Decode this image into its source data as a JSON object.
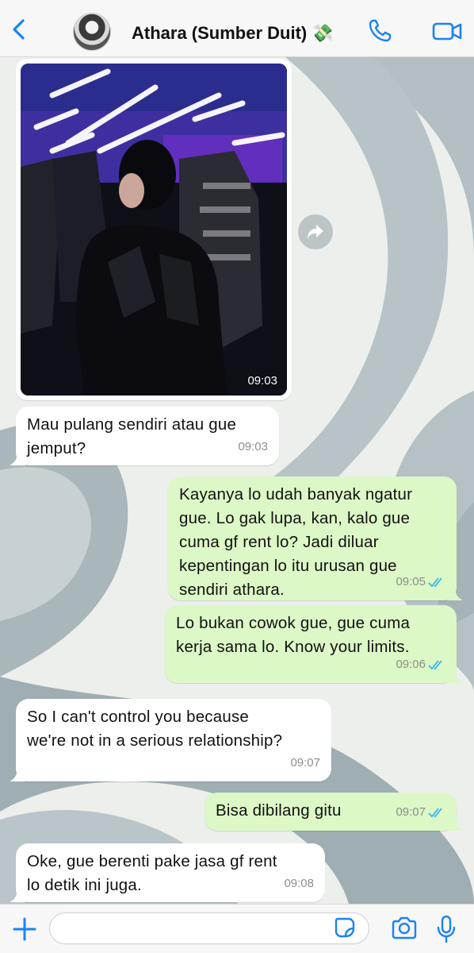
{
  "header": {
    "contact_name": "Athara (Sumber Duit) 💸",
    "icons": [
      "back-chevron-icon",
      "phone-icon",
      "video-camera-icon"
    ]
  },
  "colors": {
    "accent": "#1a82f7",
    "incoming_bubble": "#ffffff",
    "outgoing_bubble": "#dcf8c6",
    "read_ticks": "#34b7f1"
  },
  "messages": [
    {
      "direction": "in",
      "type": "image",
      "time": "09:03"
    },
    {
      "direction": "in",
      "lines": [
        "Mau pulang sendiri atau gue",
        "jemput?"
      ],
      "time": "09:03"
    },
    {
      "direction": "out",
      "lines": [
        "Kayanya lo udah banyak ngatur",
        "gue. Lo gak lupa, kan, kalo gue",
        "cuma gf rent lo? Jadi diluar",
        "kepentingan lo itu urusan gue",
        "sendiri athara."
      ],
      "time": "09:05",
      "status": "read"
    },
    {
      "direction": "out",
      "lines": [
        "Lo bukan cowok gue, gue cuma",
        "kerja sama lo. Know your limits."
      ],
      "time": "09:06",
      "status": "read"
    },
    {
      "direction": "in",
      "lines": [
        "So I can't control you because",
        "we're not in a serious relationship?"
      ],
      "time": "09:07"
    },
    {
      "direction": "out",
      "lines": [
        "Bisa dibilang gitu"
      ],
      "time": "09:07",
      "status": "read"
    },
    {
      "direction": "in",
      "lines": [
        "Oke, gue berenti pake jasa gf rent",
        "lo detik ini juga."
      ],
      "time": "09:08"
    }
  ],
  "composer": {
    "value": "",
    "icons": [
      "plus-icon",
      "sticker-icon",
      "camera-icon",
      "microphone-icon"
    ]
  }
}
